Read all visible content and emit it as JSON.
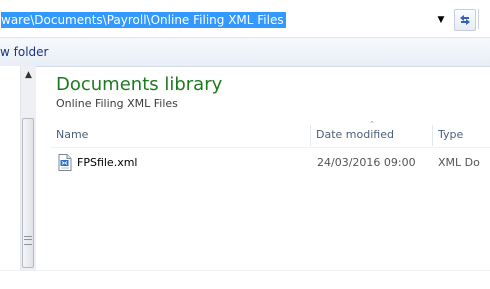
{
  "address_bar": {
    "path": "ware\\Documents\\Payroll\\Online Filing XML Files",
    "dropdown_icon": "chevron-down-icon",
    "refresh_icon": "refresh-icon"
  },
  "toolbar": {
    "new_folder_label": "w folder"
  },
  "library": {
    "title": "Documents library",
    "subtitle": "Online Filing XML Files",
    "title_color": "#1e7a1e"
  },
  "columns": {
    "name": "Name",
    "date_modified": "Date modified",
    "type": "Type"
  },
  "files": [
    {
      "name": "FPSfile.xml",
      "date_modified": "24/03/2016 09:00",
      "type": "XML Do",
      "icon": "xml-file-icon"
    }
  ],
  "colors": {
    "selection": "#3399ff",
    "toolbar_text": "#1e3287",
    "header_text": "#4c607a"
  }
}
